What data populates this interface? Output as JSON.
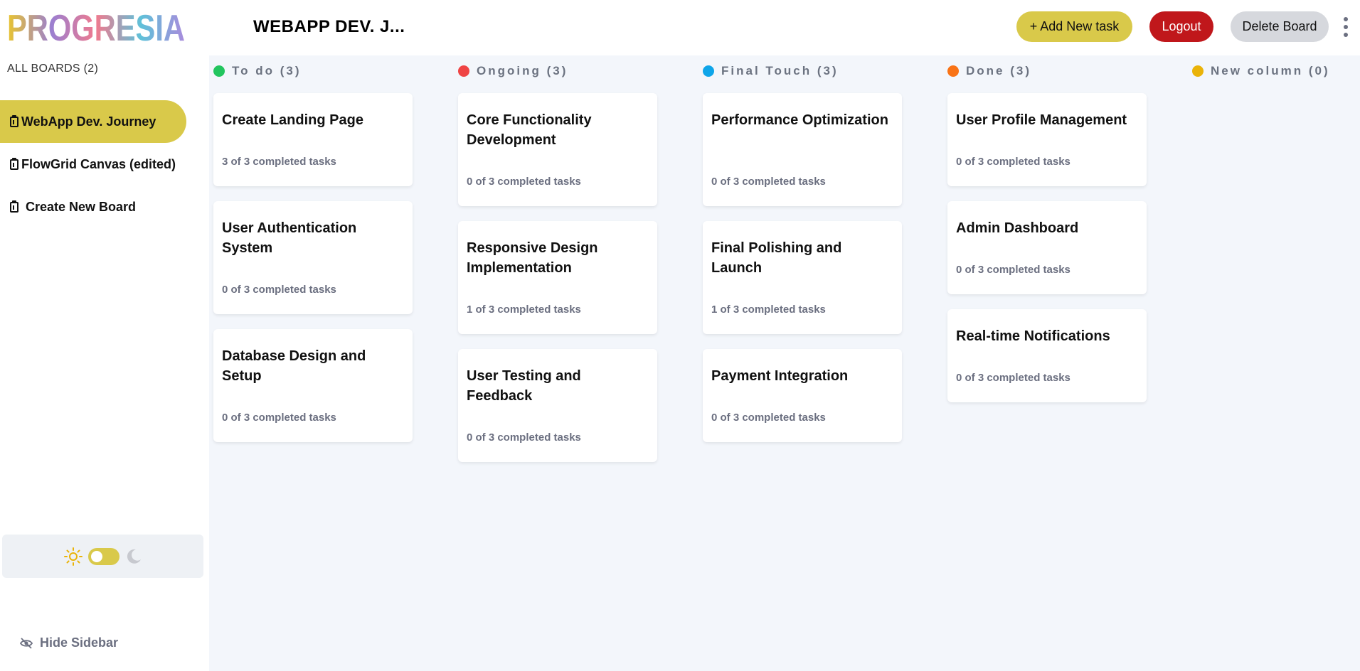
{
  "app": {
    "logo_text": "PROGRESIA",
    "board_title": "WEBAPP DEV. J..."
  },
  "header": {
    "add_task_label": "+ Add New task",
    "logout_label": "Logout",
    "delete_board_label": "Delete Board"
  },
  "sidebar": {
    "all_boards_label": "ALL BOARDS (2)",
    "boards": [
      {
        "label": "WebApp Dev. Journey",
        "active": true
      },
      {
        "label": "FlowGrid Canvas (edited)",
        "active": false
      },
      {
        "label": "Create New Board",
        "active": false
      }
    ],
    "hide_label": "Hide Sidebar",
    "theme": {
      "mode": "light"
    }
  },
  "columns": [
    {
      "name": "To do (3)",
      "color": "#22c55e",
      "cards": [
        {
          "title": "Create Landing Page",
          "subtasks": "3 of 3 completed tasks"
        },
        {
          "title": "User Authentication System",
          "subtasks": "0 of 3 completed tasks"
        },
        {
          "title": "Database Design and Setup",
          "subtasks": "0 of 3 completed tasks"
        }
      ]
    },
    {
      "name": "Ongoing (3)",
      "color": "#ef4444",
      "cards": [
        {
          "title": "Core Functionality Development",
          "subtasks": "0 of 3 completed tasks"
        },
        {
          "title": "Responsive Design Implementation",
          "subtasks": "1 of 3 completed tasks"
        },
        {
          "title": "User Testing and Feedback",
          "subtasks": "0 of 3 completed tasks"
        }
      ]
    },
    {
      "name": "Final Touch (3)",
      "color": "#0ea5e9",
      "cards": [
        {
          "title": "Performance Optimization",
          "subtasks": "0 of 3 completed tasks"
        },
        {
          "title": "Final Polishing and Launch",
          "subtasks": "1 of 3 completed tasks"
        },
        {
          "title": "Payment Integration",
          "subtasks": "0 of 3 completed tasks"
        }
      ]
    },
    {
      "name": "Done (3)",
      "color": "#f97316",
      "cards": [
        {
          "title": "User Profile Management",
          "subtasks": "0 of 3 completed tasks"
        },
        {
          "title": "Admin Dashboard",
          "subtasks": "0 of 3 completed tasks"
        },
        {
          "title": "Real-time Notifications",
          "subtasks": "0 of 3 completed tasks"
        }
      ]
    },
    {
      "name": "New column (0)",
      "color": "#eab308",
      "cards": []
    }
  ],
  "colors": {
    "accent": "#d9c94a",
    "danger": "#c0171b",
    "board_bg": "#f3f6fb"
  }
}
